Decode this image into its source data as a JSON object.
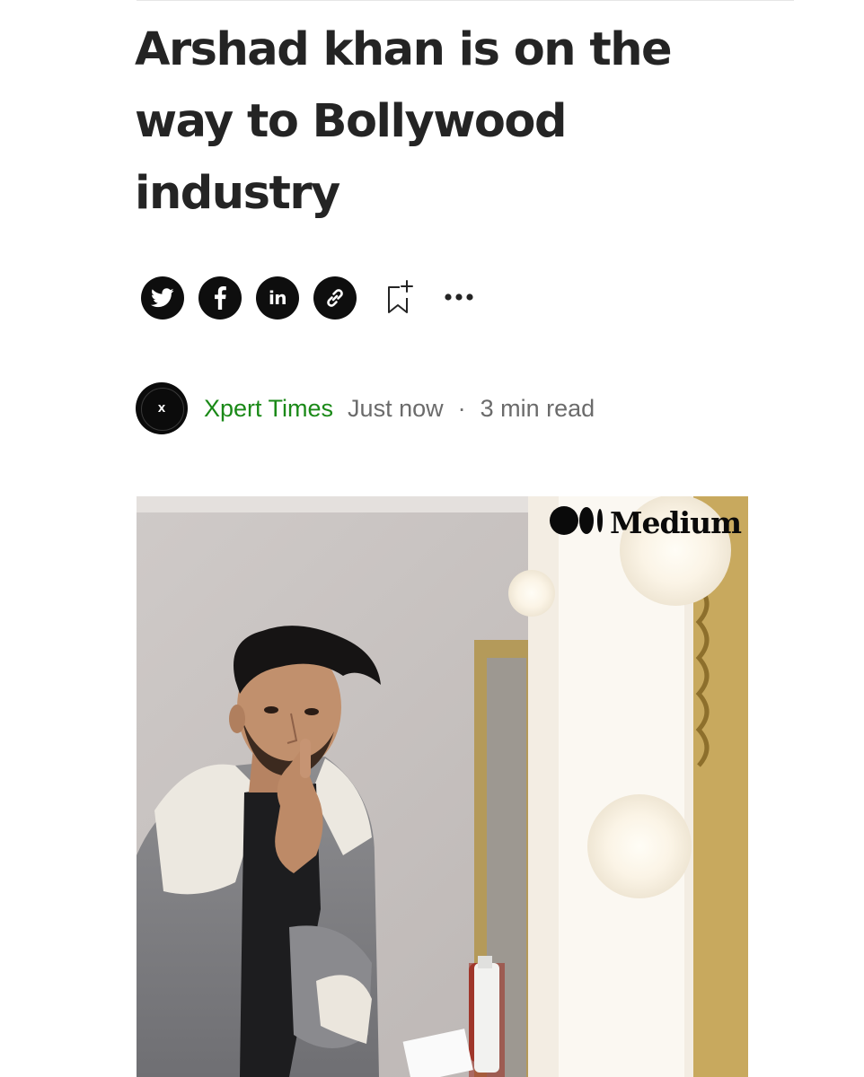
{
  "article": {
    "title": "Arshad khan is on the way to Bollywood industry"
  },
  "share_bar": {
    "twitter_icon": "twitter-icon",
    "facebook_label": "f",
    "linkedin_label": "in",
    "link_icon": "link-icon",
    "save_icon": "bookmark-plus-icon",
    "more_icon": "more-horizontal-icon"
  },
  "byline": {
    "avatar_letter": "X",
    "author": "Xpert Times",
    "posted": "Just now",
    "separator": "·",
    "read_time": "3 min read"
  },
  "hero_image": {
    "watermark": "Medium",
    "description_icon": "photo"
  },
  "colors": {
    "text": "#242424",
    "author_green": "#1a8917",
    "meta_gray": "#6b6b6b",
    "share_bg": "#0e0e0e"
  }
}
